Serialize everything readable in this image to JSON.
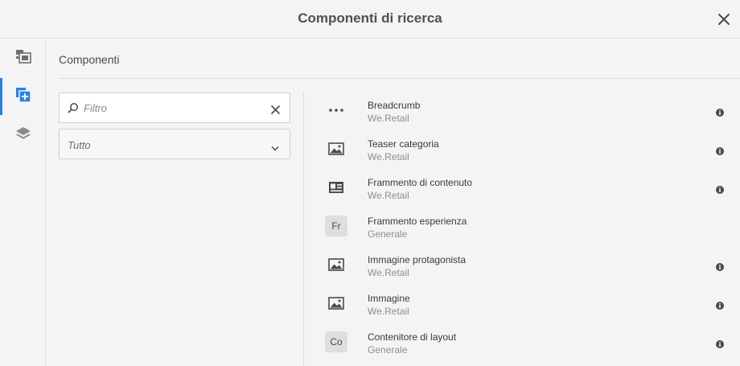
{
  "dialog": {
    "title": "Componenti di ricerca",
    "close_icon": "close-icon"
  },
  "rail": {
    "items": [
      {
        "name": "assets",
        "icon": "assets-icon",
        "active": false
      },
      {
        "name": "components",
        "icon": "components-add-icon",
        "active": true
      },
      {
        "name": "content-tree",
        "icon": "layers-icon",
        "active": false
      }
    ],
    "accent": "#2680eb"
  },
  "panel": {
    "title": "Componenti",
    "filter": {
      "value": "",
      "placeholder": "Filtro"
    },
    "group_select": {
      "selected": "Tutto"
    }
  },
  "components": [
    {
      "name": "Breadcrumb",
      "group": "We.Retail",
      "icon": "more-dots-icon",
      "abbr": "",
      "info": true
    },
    {
      "name": "Teaser categoria",
      "group": "We.Retail",
      "icon": "image-icon",
      "abbr": "",
      "info": true
    },
    {
      "name": "Frammento di contenuto",
      "group": "We.Retail",
      "icon": "content-card-icon",
      "abbr": "",
      "info": true
    },
    {
      "name": "Frammento esperienza",
      "group": "Generale",
      "icon": "",
      "abbr": "Fr",
      "info": false
    },
    {
      "name": "Immagine protagonista",
      "group": "We.Retail",
      "icon": "image-icon",
      "abbr": "",
      "info": true
    },
    {
      "name": "Immagine",
      "group": "We.Retail",
      "icon": "image-icon",
      "abbr": "",
      "info": true
    },
    {
      "name": "Contenitore di layout",
      "group": "Generale",
      "icon": "",
      "abbr": "Co",
      "info": true
    }
  ]
}
